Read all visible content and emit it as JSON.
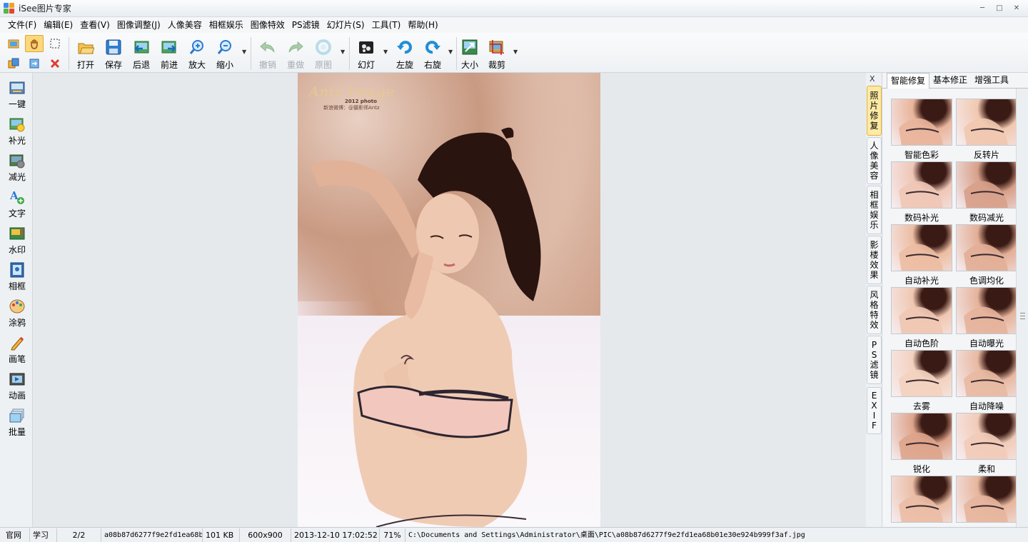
{
  "window": {
    "title": "iSee图片专家"
  },
  "menu": [
    "文件(F)",
    "编辑(E)",
    "查看(V)",
    "图像调整(J)",
    "人像美容",
    "相框娱乐",
    "图像特效",
    "PS滤镜",
    "幻灯片(S)",
    "工具(T)",
    "帮助(H)"
  ],
  "toolbar": {
    "open": "打开",
    "save": "保存",
    "back": "后退",
    "forward": "前进",
    "zoom_in": "放大",
    "zoom_out": "缩小",
    "undo": "撤销",
    "redo": "重做",
    "original": "原图",
    "slideshow": "幻灯",
    "rotate_left": "左旋",
    "rotate_right": "右旋",
    "resize": "大小",
    "crop": "裁剪"
  },
  "left_tools": [
    "一键",
    "补光",
    "减光",
    "文字",
    "水印",
    "相框",
    "涂鸦",
    "画笔",
    "动画",
    "批量"
  ],
  "photo": {
    "watermark_title": "Antz Image",
    "watermark_sub": "2012 photo",
    "watermark_line": "新浪微博：@摄影师Antz"
  },
  "vertical_tabs": {
    "close": "X",
    "items": [
      [
        "照",
        "片",
        "修",
        "复"
      ],
      [
        "人",
        "像",
        "美",
        "容"
      ],
      [
        "相",
        "框",
        "娱",
        "乐"
      ],
      [
        "影",
        "楼",
        "效",
        "果"
      ],
      [
        "风",
        "格",
        "特",
        "效"
      ],
      [
        "P",
        "S",
        "滤",
        "镜"
      ],
      [
        "E",
        "X",
        "I",
        "F"
      ]
    ]
  },
  "right_panel": {
    "tabs": [
      "智能修复",
      "基本修正",
      "增强工具"
    ],
    "effects": [
      "智能色彩",
      "反转片",
      "数码补光",
      "数码减光",
      "自动补光",
      "色调均化",
      "自动色阶",
      "自动曝光",
      "去雾",
      "自动降噪",
      "锐化",
      "柔和",
      "",
      ""
    ]
  },
  "status": {
    "site": "官网",
    "learn": "学习",
    "page": "2/2",
    "filename": "a08b87d6277f9e2fd1ea68b",
    "size": "101 KB",
    "dimensions": "600x900",
    "datetime": "2013-12-10 17:02:52",
    "zoom": "71%",
    "path": "C:\\Documents and Settings\\Administrator\\桌面\\PIC\\a08b87d6277f9e2fd1ea68b01e30e924b999f3af.jpg"
  },
  "colors": {
    "accent_tab": "#fdeaa4",
    "active_tool": "#fbd87a",
    "close_red": "#e23b2e"
  }
}
